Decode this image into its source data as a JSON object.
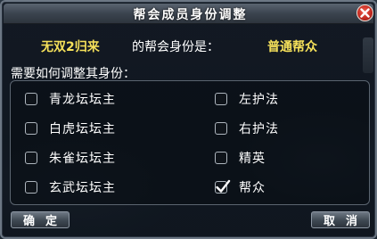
{
  "dialog": {
    "title": "帮会成员身份调整",
    "member_name": "无双2归来",
    "role_prompt": "的帮会身份是：",
    "current_role": "普通帮众",
    "question": "需要如何调整其身份：",
    "options": [
      {
        "label": "青龙坛坛主",
        "checked": false
      },
      {
        "label": "白虎坛坛主",
        "checked": false
      },
      {
        "label": "朱雀坛坛主",
        "checked": false
      },
      {
        "label": "玄武坛坛主",
        "checked": false
      },
      {
        "label": "左护法",
        "checked": false
      },
      {
        "label": "右护法",
        "checked": false
      },
      {
        "label": "精英",
        "checked": false
      },
      {
        "label": "帮众",
        "checked": true
      }
    ],
    "confirm_label": "确定",
    "cancel_label": "取消"
  },
  "colors": {
    "highlight_text": "#f6e15a",
    "close_button": "#c42a20"
  },
  "icons": {
    "close": "close-x-icon",
    "check": "checkmark-icon"
  }
}
